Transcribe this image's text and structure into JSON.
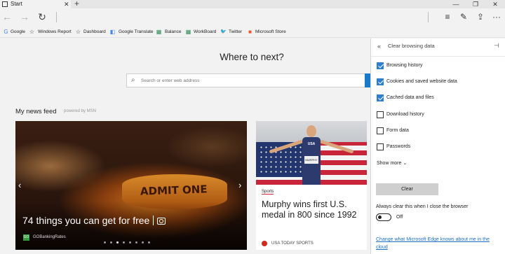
{
  "window": {
    "tab_title": "Start",
    "tab_close": "✕",
    "new_tab": "+",
    "controls": [
      "—",
      "❐",
      "✕"
    ]
  },
  "nav": {
    "back": "←",
    "forward": "→",
    "refresh": "↻"
  },
  "toolbar": {
    "hub": "≡",
    "note": "✎",
    "share": "⇪",
    "more": "···"
  },
  "favorites": [
    {
      "label": "Google",
      "icon": "G",
      "color": "#4285f4"
    },
    {
      "label": "Windows Report",
      "icon": "☆",
      "color": "#333333"
    },
    {
      "label": "Dashboard",
      "icon": "☆",
      "color": "#333333"
    },
    {
      "label": "Google Translate",
      "icon": "◧",
      "color": "#4285f4"
    },
    {
      "label": "Balance",
      "icon": "▦",
      "color": "#2e8b57"
    },
    {
      "label": "WorkBoard",
      "icon": "▦",
      "color": "#2e8b57"
    },
    {
      "label": "Twitter",
      "icon": "🐦",
      "color": "#1da1f2"
    },
    {
      "label": "Microsoft Store",
      "icon": "■",
      "color": "#f25022"
    }
  ],
  "start": {
    "heading": "Where to next?",
    "search_placeholder": "Search or enter web address",
    "feed_title": "My news feed",
    "powered_by": "powered by MSN"
  },
  "cards": {
    "big": {
      "headline": "74 things you can get for free",
      "image_text": "ADMIT ONE",
      "source_badge": "GO",
      "source": "GOBankingRates",
      "dot_count": 8,
      "active_dot": 2
    },
    "second": {
      "category": "Sports",
      "headline": "Murphy wins first U.S. medal in 800 since 1992",
      "source": "USA TODAY SPORTS",
      "jersey": "USA",
      "bib": "MURPHY"
    }
  },
  "hub": {
    "title": "Clear browsing data",
    "back": "«",
    "pin": "⊣",
    "options": [
      {
        "label": "Browsing history",
        "checked": true
      },
      {
        "label": "Cookies and saved website data",
        "checked": true
      },
      {
        "label": "Cached data and files",
        "checked": true
      },
      {
        "label": "Download history",
        "checked": false
      },
      {
        "label": "Form data",
        "checked": false
      },
      {
        "label": "Passwords",
        "checked": false
      }
    ],
    "show_more": "Show more ⌄",
    "clear_button": "Clear",
    "always_clear": "Always clear this when I close the browser",
    "toggle_label": "Off",
    "toggle_on": false,
    "link": "Change what Microsoft Edge knows about me in the cloud"
  }
}
